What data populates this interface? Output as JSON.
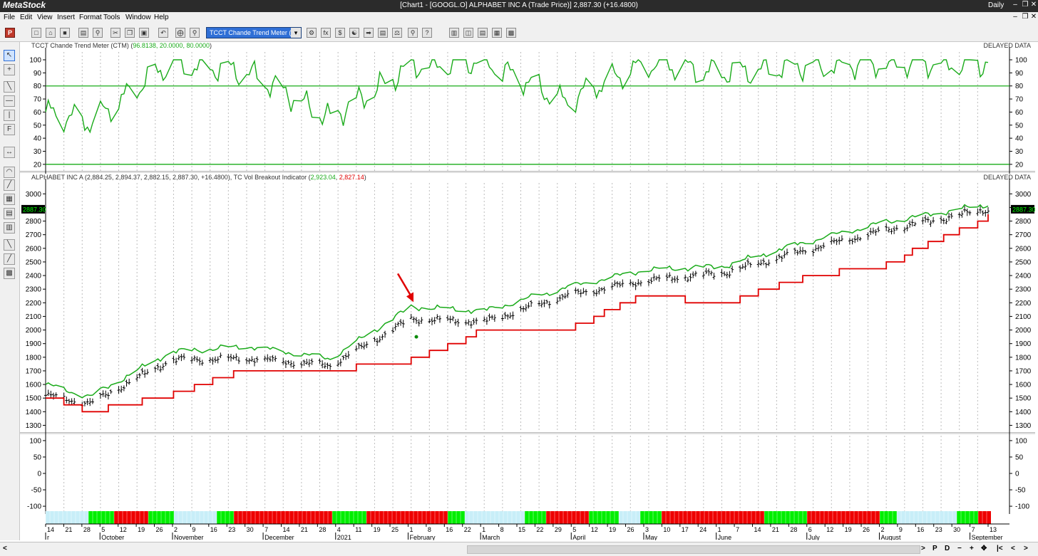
{
  "app": {
    "name": "MetaStock",
    "window_title": "[Chart1 - [GOOGL.O] ALPHABET INC A (Trade Price)]   2,887.30 (+16.4800)",
    "period": "Daily"
  },
  "menu": [
    "File",
    "Edit",
    "View",
    "Insert",
    "Format",
    "Tools",
    "Window",
    "Help"
  ],
  "toolbar": {
    "indicator_select": "TCCT Chande Trend Meter ("
  },
  "ctm_pane": {
    "header": "TCCT Chande Trend Meter (CTM) (",
    "values_text": "96.8138, 20.0000, 80.0000",
    "close_paren": ")",
    "delayed": "DELAYED DATA",
    "ticks": [
      "100",
      "90",
      "80",
      "70",
      "60",
      "50",
      "40",
      "30",
      "20"
    ],
    "upper_level": 80,
    "lower_level": 20
  },
  "price_pane": {
    "header_prefix": "ALPHABET INC A (2,884.25, 2,894.37, 2,882.15, 2,887.30, +16.4800), TC Vol Breakout Indicator (",
    "green_value": "2,923.04",
    "comma": ", ",
    "red_value": "2,827.14",
    "close_paren": ")",
    "delayed": "DELAYED DATA",
    "ticks": [
      "3000",
      "2900",
      "2800",
      "2700",
      "2600",
      "2500",
      "2400",
      "2300",
      "2200",
      "2100",
      "2000",
      "1900",
      "1800",
      "1700",
      "1600",
      "1500",
      "1400",
      "1300"
    ],
    "last_price_badge": "2887.30"
  },
  "osc_pane": {
    "ticks": [
      "100",
      "50",
      "0",
      "-50",
      "-100"
    ]
  },
  "xaxis": {
    "days": [
      "14",
      "21",
      "28",
      "5",
      "12",
      "19",
      "26",
      "2",
      "9",
      "16",
      "23",
      "30",
      "7",
      "14",
      "21",
      "28",
      "4",
      "11",
      "19",
      "25",
      "1",
      "8",
      "16",
      "22",
      "1",
      "8",
      "15",
      "22",
      "29",
      "5",
      "12",
      "19",
      "26",
      "3",
      "10",
      "17",
      "24",
      "1",
      "7",
      "14",
      "21",
      "28",
      "6",
      "12",
      "19",
      "26",
      "2",
      "9",
      "16",
      "23",
      "30",
      "7",
      "13"
    ],
    "months": [
      "r",
      "October",
      "November",
      "December",
      "2021",
      "February",
      "March",
      "April",
      "May",
      "June",
      "July",
      "August",
      "September"
    ]
  },
  "colors": {
    "green": "#1aab1a",
    "red": "#e00000",
    "bar_green": "#00ee00",
    "bar_red": "#ee0000",
    "bar_cyan": "#c8eef8"
  },
  "bottom": {
    "p": "P",
    "d": "D"
  },
  "chart_data": {
    "type": "line",
    "x": [
      "2020-09-14",
      "2020-10-01",
      "2020-11-01",
      "2020-12-01",
      "2021-01-01",
      "2021-02-01",
      "2021-03-01",
      "2021-04-01",
      "2021-05-01",
      "2021-06-01",
      "2021-07-01",
      "2021-08-01",
      "2021-09-10"
    ],
    "series": [
      {
        "name": "Close",
        "values": [
          1520,
          1460,
          1780,
          1790,
          1740,
          2080,
          2060,
          2250,
          2360,
          2420,
          2580,
          2730,
          2887
        ]
      },
      {
        "name": "TC Vol Breakout Indicator",
        "values": [
          1600,
          1510,
          1840,
          1880,
          1790,
          2170,
          2140,
          2310,
          2440,
          2470,
          2640,
          2790,
          2923
        ]
      },
      {
        "name": "TC Vol Breakout Indicator (lower)",
        "values": [
          1510,
          1400,
          1520,
          1720,
          1700,
          1780,
          2000,
          2010,
          2250,
          2200,
          2380,
          2480,
          2827
        ]
      },
      {
        "name": "TCCT Chande Trend Meter (CTM)",
        "values": [
          60,
          52,
          98,
          90,
          55,
          95,
          99,
          68,
          97,
          90,
          95,
          97,
          97
        ]
      }
    ],
    "ylim_price": [
      1250,
      3080
    ],
    "ylim_ctm": [
      15,
      106
    ],
    "ylim_osc": [
      -115,
      115
    ],
    "grid": true,
    "legend": "none"
  }
}
